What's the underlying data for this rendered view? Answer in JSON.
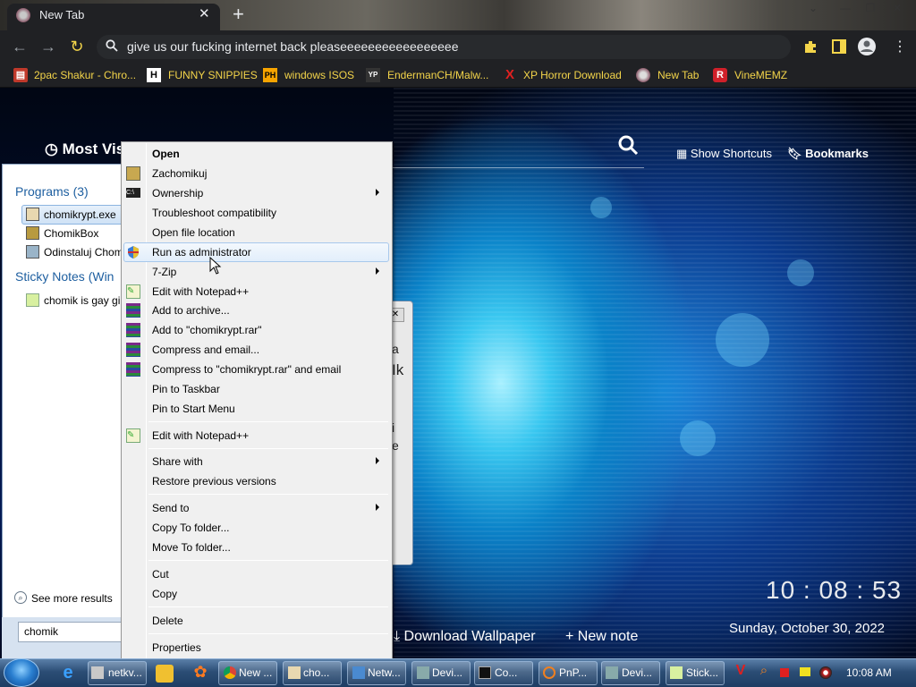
{
  "browser": {
    "tab_title": "New Tab",
    "tab_close": "✕",
    "new_tab": "+",
    "url": "give us our fucking internet back pleaseeeeeeeeeeeeeeeee",
    "window_controls": [
      "⌄",
      "—",
      "❐",
      "✕"
    ]
  },
  "bookmarks": [
    {
      "label": "2pac Shakur - Chro...",
      "icon": "bag-icon"
    },
    {
      "label": "FUNNY SNIPPIES",
      "icon": "H"
    },
    {
      "label": "windows ISOS",
      "icon": "PH"
    },
    {
      "label": "EndermanCH/Malw...",
      "icon": "YP"
    },
    {
      "label": "XP Horror Download",
      "icon": "X"
    },
    {
      "label": "New Tab",
      "icon": "globe-icon"
    },
    {
      "label": "VineMEMZ",
      "icon": "R"
    }
  ],
  "newtab": {
    "most_visited": "Most Visi",
    "show_shortcuts": "Show Shortcuts",
    "bookmarks": "Bookmarks",
    "clock": "10 : 08 : 53",
    "date": "Sunday, October 30, 2022",
    "download_wallpaper": "Download Wallpaper",
    "new_note": "+ New note"
  },
  "dialog": {
    "lines": [
      "a",
      "Ik",
      "i",
      "e"
    ]
  },
  "start_menu": {
    "programs_header": "Programs (3)",
    "programs": [
      "chomikrypt.exe",
      "ChomikBox",
      "Odinstaluj Chom"
    ],
    "notes_header": "Sticky Notes (Win",
    "notes": [
      "chomik is gay gi"
    ],
    "see_more": "See more results",
    "search_value": "chomik"
  },
  "context_menu": {
    "items": [
      {
        "label": "Open",
        "bold": true
      },
      {
        "label": "Zachomikuj"
      },
      {
        "label": "Ownership",
        "submenu": true
      },
      {
        "label": "Troubleshoot compatibility"
      },
      {
        "label": "Open file location"
      },
      {
        "label": "Run as administrator",
        "highlighted": true
      },
      {
        "label": "7-Zip",
        "submenu": true
      },
      {
        "label": "Edit with Notepad++"
      },
      {
        "label": "Add to archive..."
      },
      {
        "label": "Add to \"chomikrypt.rar\""
      },
      {
        "label": "Compress and email..."
      },
      {
        "label": "Compress to \"chomikrypt.rar\" and email"
      },
      {
        "label": "Pin to Taskbar"
      },
      {
        "label": "Pin to Start Menu"
      },
      {
        "label": "Edit with Notepad++"
      },
      {
        "label": "Share with",
        "submenu": true
      },
      {
        "label": "Restore previous versions"
      },
      {
        "label": "Send to",
        "submenu": true
      },
      {
        "label": "Copy To folder..."
      },
      {
        "label": "Move To folder..."
      },
      {
        "label": "Cut"
      },
      {
        "label": "Copy"
      },
      {
        "label": "Delete"
      },
      {
        "label": "Properties"
      }
    ]
  },
  "taskbar": {
    "buttons": [
      "netkv...",
      "New ...",
      "cho...",
      "Netw...",
      "Devi...",
      "Co...",
      "PnP...",
      "Devi...",
      "Stick..."
    ],
    "time": "10:08 AM"
  },
  "colors": {
    "bookmark_text": "#f4d54a",
    "accent": "#1e5fa0"
  }
}
